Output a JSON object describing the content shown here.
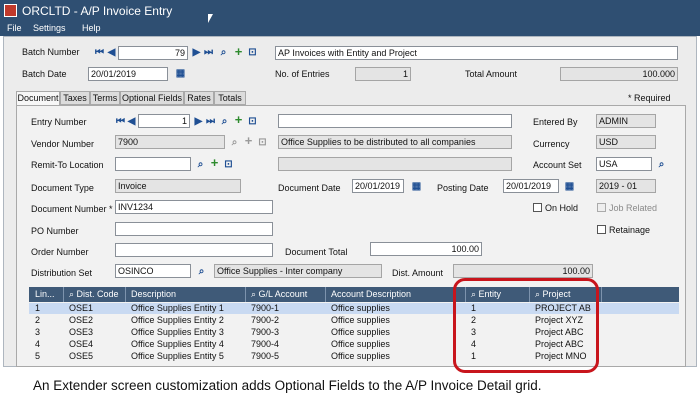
{
  "window": {
    "title": "ORCLTD - A/P Invoice Entry"
  },
  "menu": [
    "File",
    "Settings",
    "Help"
  ],
  "header": {
    "batch_number_label": "Batch Number",
    "batch_number": "79",
    "batch_desc": "AP Invoices with Entity and Project",
    "batch_date_label": "Batch Date",
    "batch_date": "20/01/2019",
    "entries_label": "No. of Entries",
    "entries": "1",
    "total_amount_label": "Total Amount",
    "total_amount": "100.000"
  },
  "tabs": [
    "Document",
    "Taxes",
    "Terms",
    "Optional Fields",
    "Rates",
    "Totals"
  ],
  "required_note": "* Required",
  "form": {
    "entry_number_label": "Entry Number",
    "entry_number": "1",
    "entered_by_label": "Entered By",
    "entered_by": "ADMIN",
    "vendor_number_label": "Vendor Number",
    "vendor_number": "7900",
    "vendor_desc": "Office Supplies to be distributed to all companies",
    "currency_label": "Currency",
    "currency": "USD",
    "remit_to_label": "Remit-To Location",
    "account_set_label": "Account Set",
    "account_set": "USA",
    "document_type_label": "Document Type",
    "document_type": "Invoice",
    "document_date_label": "Document Date",
    "document_date": "20/01/2019",
    "posting_date_label": "Posting Date",
    "posting_date": "20/01/2019",
    "period": "2019 - 01",
    "document_number_label": "Document Number *",
    "document_number": "INV1234",
    "on_hold_label": "On Hold",
    "job_related_label": "Job Related",
    "po_number_label": "PO Number",
    "retainage_label": "Retainage",
    "order_number_label": "Order Number",
    "document_total_label": "Document Total",
    "document_total": "100.00",
    "distribution_set_label": "Distribution Set",
    "distribution_set": "OSINCO",
    "distribution_set_desc": "Office Supplies - Inter company",
    "dist_amount_label": "Dist. Amount",
    "dist_amount": "100.00"
  },
  "grid": {
    "columns": [
      "Lin...",
      "Dist. Code",
      "Description",
      "G/L Account",
      "Account Description",
      "Entity",
      "Project"
    ],
    "rows": [
      [
        "1",
        "OSE1",
        "Office Supplies Entity 1",
        "7900-1",
        "Office supplies",
        "1",
        "PROJECT AB"
      ],
      [
        "2",
        "OSE2",
        "Office Supplies Entity 2",
        "7900-2",
        "Office supplies",
        "2",
        "Project XYZ"
      ],
      [
        "3",
        "OSE3",
        "Office Supplies Entity 3",
        "7900-3",
        "Office supplies",
        "3",
        "Project ABC"
      ],
      [
        "4",
        "OSE4",
        "Office Supplies Entity 4",
        "7900-4",
        "Office supplies",
        "4",
        "Project ABC"
      ],
      [
        "5",
        "OSE5",
        "Office Supplies Entity 5",
        "7900-5",
        "Office supplies",
        "1",
        "Project MNO"
      ]
    ]
  },
  "caption": "An Extender screen customization adds Optional Fields to the A/P Invoice Detail grid.",
  "colors": {
    "titlebar": "#2f4f72",
    "grid_header": "#3f5a78",
    "highlight": "#c8151c"
  },
  "icons": [
    "app-icon",
    "first-record-icon",
    "previous-record-icon",
    "next-record-icon",
    "last-record-icon",
    "search-icon",
    "add-icon",
    "save-icon",
    "calendar-icon",
    "zoom-icon"
  ]
}
